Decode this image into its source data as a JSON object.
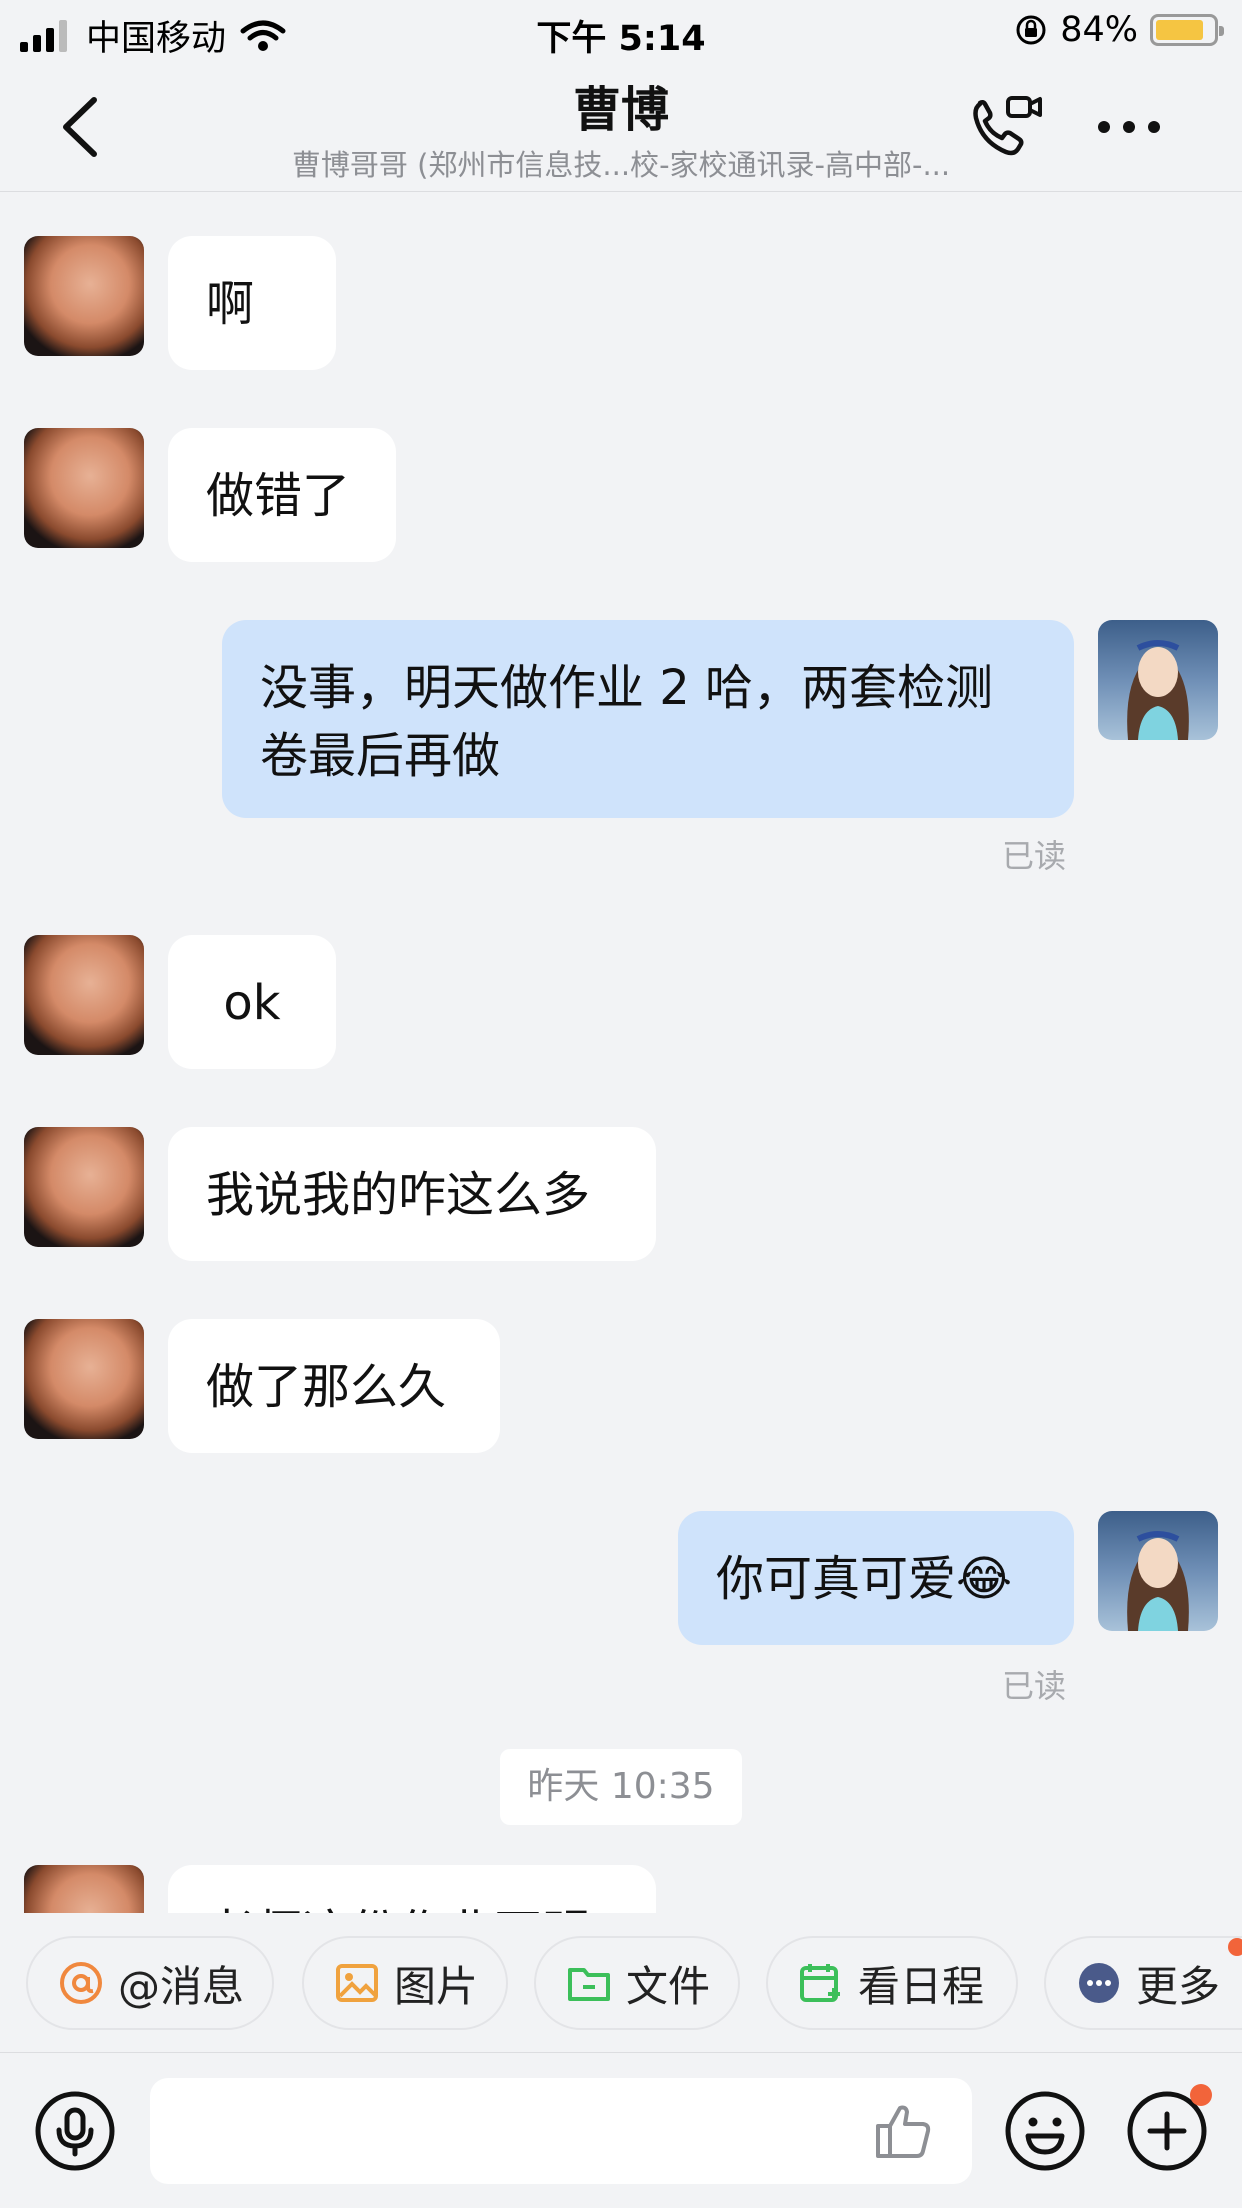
{
  "status_bar": {
    "carrier": "中国移动",
    "time": "下午 5:14",
    "battery_percent": "84%",
    "battery_level": 0.84
  },
  "header": {
    "title": "曹博",
    "subtitle": "曹博哥哥 (郑州市信息技...校-家校通讯录-高中部-...",
    "icons": [
      "back-icon",
      "video-call-icon",
      "more-icon"
    ]
  },
  "messages": [
    {
      "side": "in",
      "text": "啊"
    },
    {
      "side": "in",
      "text": "做错了"
    },
    {
      "side": "out",
      "text_line1": "没事，明天做作业 2 哈，两套检测",
      "text_line2": "卷最后再做",
      "status": "已读"
    },
    {
      "side": "in",
      "text": "ok"
    },
    {
      "side": "in",
      "text": "我说我的咋这么多"
    },
    {
      "side": "in",
      "text": "做了那么久"
    },
    {
      "side": "out",
      "text": "你可真可爱😂",
      "status": "已读"
    },
    {
      "type": "time",
      "text": "昨天 10:35"
    },
    {
      "side": "in",
      "text": "老师这份作业不明"
    }
  ],
  "quick_actions": [
    {
      "label": "@消息",
      "icon": "at-icon",
      "color": "#f0883e"
    },
    {
      "label": "图片",
      "icon": "image-icon",
      "color": "#f0a23e"
    },
    {
      "label": "文件",
      "icon": "folder-icon",
      "color": "#3cbf5a"
    },
    {
      "label": "看日程",
      "icon": "calendar-icon",
      "color": "#3cbf5a"
    },
    {
      "label": "更多",
      "icon": "more-dots-icon",
      "color": "#4a5a8a"
    }
  ],
  "input_bar": {
    "icons": [
      "microphone-icon",
      "thumbs-up-icon",
      "emoji-icon",
      "plus-icon"
    ]
  },
  "colors": {
    "background": "#f2f3f5",
    "outgoing_bubble": "#cfe3fb",
    "incoming_bubble": "#ffffff",
    "notification_dot": "#f2643a"
  }
}
